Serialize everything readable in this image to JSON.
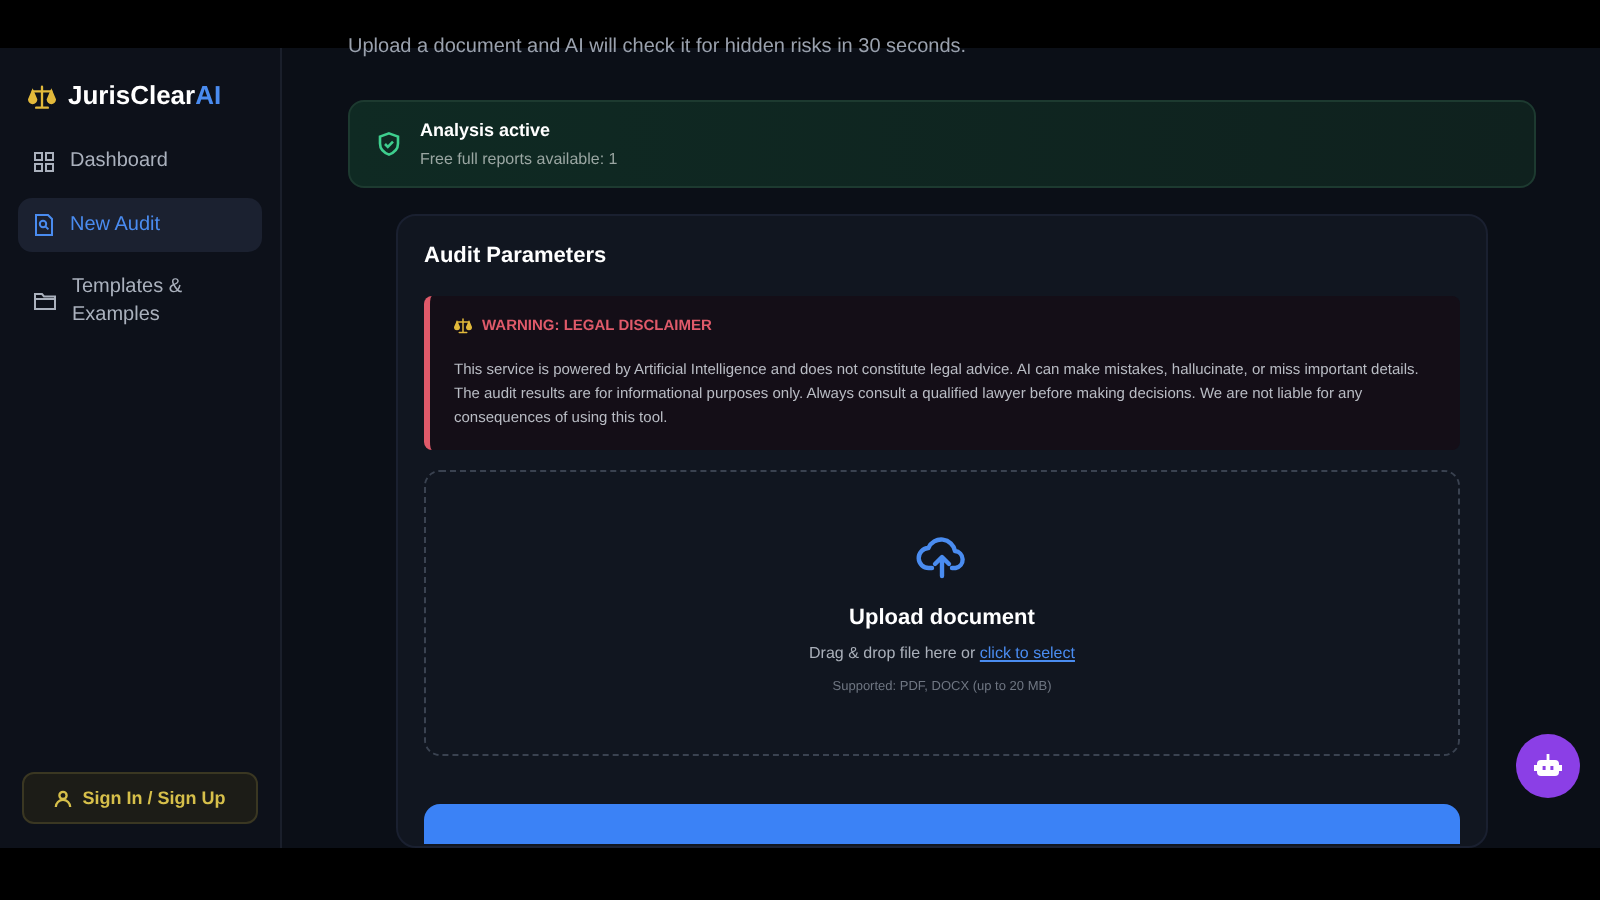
{
  "sidebar": {
    "brand": {
      "name": "JurisClear",
      "suffix": "AI"
    },
    "items": [
      {
        "label": "Dashboard",
        "kind": "grid",
        "selected": false
      },
      {
        "label": "New Audit",
        "kind": "doc",
        "selected": true
      },
      {
        "label": "Templates & Examples",
        "kind": "folder",
        "selected": false
      }
    ],
    "sign_in": "Sign In / Sign Up"
  },
  "main": {
    "subtitle": "Upload a document and AI will check it for hidden risks in 30 seconds.",
    "status": {
      "title": "Analysis active",
      "detail": "Free full reports available: 1"
    },
    "panel": {
      "title": "Audit Parameters",
      "warning": {
        "title": "WARNING: LEGAL DISCLAIMER",
        "text": "This service is powered by Artificial Intelligence and does not constitute legal advice. AI can make mistakes, hallucinate, or miss important details. The audit results are for informational purposes only. Always consult a qualified lawyer before making decisions. We are not liable for any consequences of using this tool."
      },
      "upload": {
        "title": "Upload document",
        "hint": "Drag & drop file here or",
        "link": "click to select",
        "supported": "Supported: PDF, DOCX (up to 20 MB)"
      }
    }
  }
}
